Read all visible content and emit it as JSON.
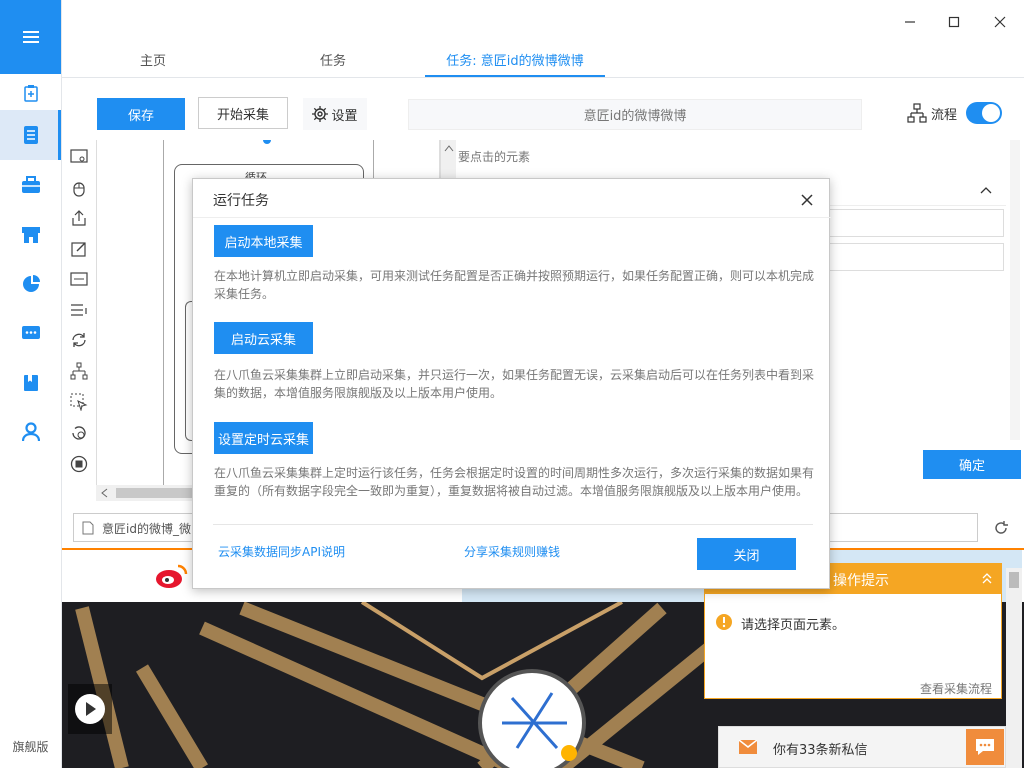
{
  "sidebar": {
    "footer_label": "旗舰版",
    "items": [
      {
        "icon": "task-add-icon"
      },
      {
        "icon": "document-icon"
      },
      {
        "icon": "briefcase-icon"
      },
      {
        "icon": "store-icon"
      },
      {
        "icon": "pie-chart-icon"
      },
      {
        "icon": "chat-icon"
      },
      {
        "icon": "book-icon"
      },
      {
        "icon": "user-icon"
      }
    ]
  },
  "tabs": [
    {
      "label": "主页"
    },
    {
      "label": "任务"
    },
    {
      "label": "任务: 意匠id的微博微博"
    }
  ],
  "toolbar": {
    "save_label": "保存",
    "start_label": "开始采集",
    "settings_label": "设置",
    "task_name": "意匠id的微博微博",
    "flow_label": "流程"
  },
  "canvas": {
    "loop_label": "循环"
  },
  "right_panel": {
    "header": "要点击的元素",
    "confirm_label": "确定"
  },
  "browser": {
    "url": "意匠id的微博_微"
  },
  "dialog": {
    "title": "运行任务",
    "local_button": "启动本地采集",
    "local_desc": "在本地计算机立即启动采集，可用来测试任务配置是否正确并按照预期运行，如果任务配置正确，则可以本机完成采集任务。",
    "cloud_button": "启动云采集",
    "cloud_desc": "在八爪鱼云采集集群上立即启动采集，并只运行一次，如果任务配置无误，云采集启动后可以在任务列表中看到采集的数据，本增值服务限旗舰版及以上版本用户使用。",
    "schedule_button": "设置定时云采集",
    "schedule_desc": "在八爪鱼云采集集群上定时运行该任务，任务会根据定时设置的时间周期性多次运行，多次运行采集的数据如果有重复的（所有数据字段完全一致即为重复），重复数据将被自动过滤。本增值服务限旗舰版及以上版本用户使用。",
    "api_link": "云采集数据同步API说明",
    "share_link": "分享采集规则赚钱",
    "close_button": "关闭"
  },
  "hint": {
    "title": "操作提示",
    "message": "请选择页面元素。",
    "link": "查看采集流程"
  },
  "messages": {
    "text": "你有33条新私信"
  },
  "colors": {
    "accent": "#1f8ef1",
    "hint": "#f5a623",
    "weibo": "#ff8200"
  }
}
